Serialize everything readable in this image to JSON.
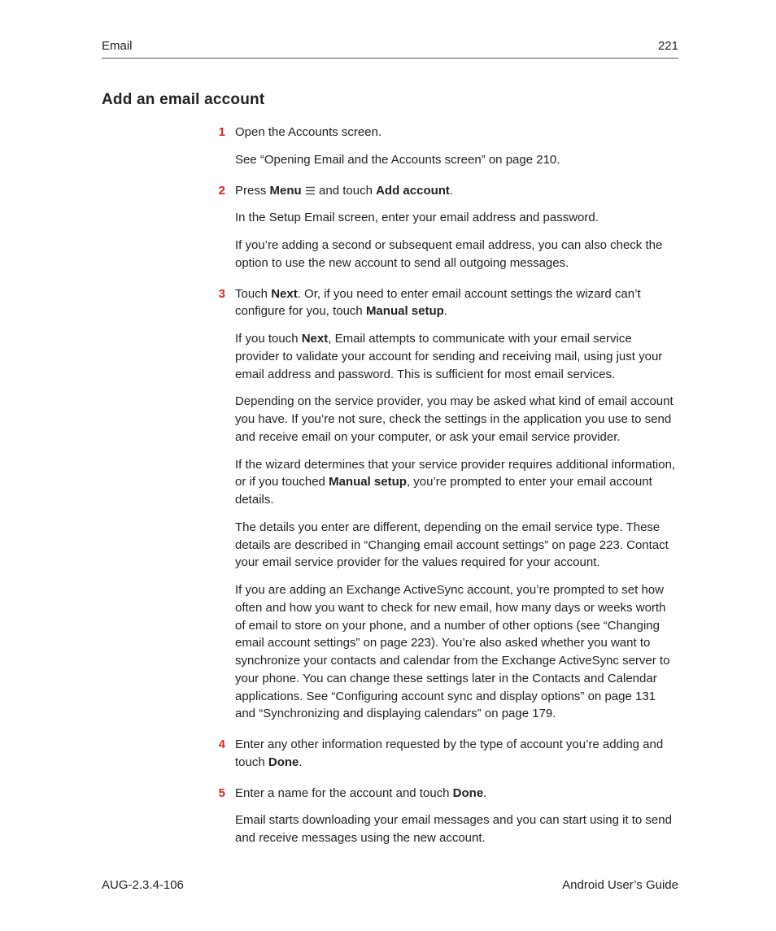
{
  "header": {
    "section": "Email",
    "page": "221"
  },
  "title": "Add an email account",
  "steps": [
    {
      "num": "1",
      "lead_parts": [
        "Open the Accounts screen."
      ],
      "paras": [
        "See “Opening Email and the Accounts screen” on page 210."
      ]
    },
    {
      "num": "2",
      "lead_parts": [
        "Press ",
        "Menu",
        " ",
        "ICON",
        " and touch ",
        "Add account",
        "."
      ],
      "paras": [
        "In the Setup Email screen, enter your email address and password.",
        "If you’re adding a second or subsequent email address, you can also check the option to use the new account to send all outgoing messages."
      ]
    },
    {
      "num": "3",
      "lead_parts": [
        "Touch ",
        "Next",
        ". Or, if you need to enter email account settings the wizard can’t configure for you, touch ",
        "Manual setup",
        "."
      ],
      "rich_paras": [
        [
          "If you touch ",
          "Next",
          ", Email attempts to communicate with your email service provider to validate your account for sending and receiving mail, using just your email address and password. This is sufficient for most email services."
        ],
        [
          "Depending on the service provider, you may be asked what kind of email account you have. If you’re not sure, check the settings in the application you use to send and receive email on your computer, or ask your email service provider."
        ],
        [
          "If the wizard determines that your service provider requires additional information, or if you touched ",
          "Manual setup",
          ", you’re prompted to enter your email account details."
        ],
        [
          "The details you enter are different, depending on the email service type. These details are described in “Changing email account settings” on page 223. Contact your email service provider for the values required for your account."
        ],
        [
          "If you are adding an Exchange ActiveSync account, you’re prompted to set how often and how you want to check for new email, how many days or weeks worth of email to store on your phone, and a number of other options (see “Changing email account settings” on page 223). You’re also asked whether you want to synchronize your contacts and calendar from the Exchange ActiveSync server to your phone. You can change these settings later in the Contacts and Calendar applications. See “Configuring account sync and display options” on page 131 and “Synchronizing and displaying calendars” on page 179."
        ]
      ]
    },
    {
      "num": "4",
      "lead_parts": [
        "Enter any other information requested by the type of account you’re adding and touch ",
        "Done",
        "."
      ]
    },
    {
      "num": "5",
      "lead_parts": [
        "Enter a name for the account and touch ",
        "Done",
        "."
      ],
      "paras": [
        "Email starts downloading your email messages and you can start using it to send and receive messages using the new account."
      ]
    }
  ],
  "footer": {
    "left": "AUG-2.3.4-106",
    "right": "Android User’s Guide"
  }
}
